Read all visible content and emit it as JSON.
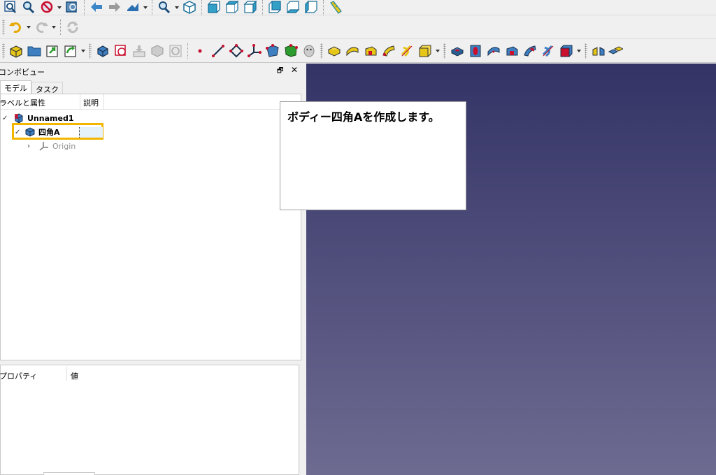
{
  "toolbar": {
    "row1_icons": [
      "view-fit-all-icon",
      "zoom-selection-icon",
      "draw-style-icon",
      "bounding-box-icon",
      "nav-back-icon",
      "nav-forward-icon",
      "sync-view-icon",
      "zoom-icon",
      "view-isometric-icon",
      "view-front-icon",
      "view-top-icon",
      "view-right-icon",
      "view-rear-icon",
      "view-bottom-icon",
      "view-left-icon",
      "measure-icon"
    ],
    "row2_icons": [
      "undo-icon",
      "redo-icon",
      "refresh-icon"
    ],
    "row3_icons": [
      "part-icon",
      "open-folder-icon",
      "link-icon",
      "sub-link-icon",
      "body-icon",
      "sketch-icon",
      "shape-binder-icon",
      "clone-icon",
      "sub-shape-binder-icon",
      "datum-point-icon",
      "datum-line-icon",
      "datum-plane-icon",
      "local-cs-icon",
      "shape-binder2-icon",
      "sub-shape-binder2-icon",
      "clone2-icon",
      "pad-icon",
      "revolution-icon",
      "additive-loft-icon",
      "additive-pipe-icon",
      "additive-helix-icon",
      "additive-box-icon",
      "pocket-icon",
      "hole-icon",
      "groove-icon",
      "subtractive-loft-icon",
      "subtractive-pipe-icon",
      "subtractive-helix-icon",
      "subtractive-box-icon",
      "mirrored-icon",
      "linear-pattern-icon"
    ]
  },
  "combo": {
    "title": "コンボビュー",
    "float_symbol": "🗗",
    "close_symbol": "✕",
    "tabs": {
      "model": "モデル",
      "task": "タスク"
    }
  },
  "tree": {
    "col_label": "ラベルと属性",
    "col_desc": "説明",
    "doc_name": "Unnamed1",
    "body_name": "四角A",
    "origin_name": "Origin",
    "expand_open": "✓",
    "expand_closed": "›"
  },
  "properties": {
    "col_prop": "プロパティ",
    "col_value": "値"
  },
  "tooltip": {
    "text": "ボディー四角Aを作成します。"
  },
  "colors": {
    "viewport_top": "#333366",
    "viewport_bottom": "#6e6b91",
    "highlight": "#f2b600"
  }
}
